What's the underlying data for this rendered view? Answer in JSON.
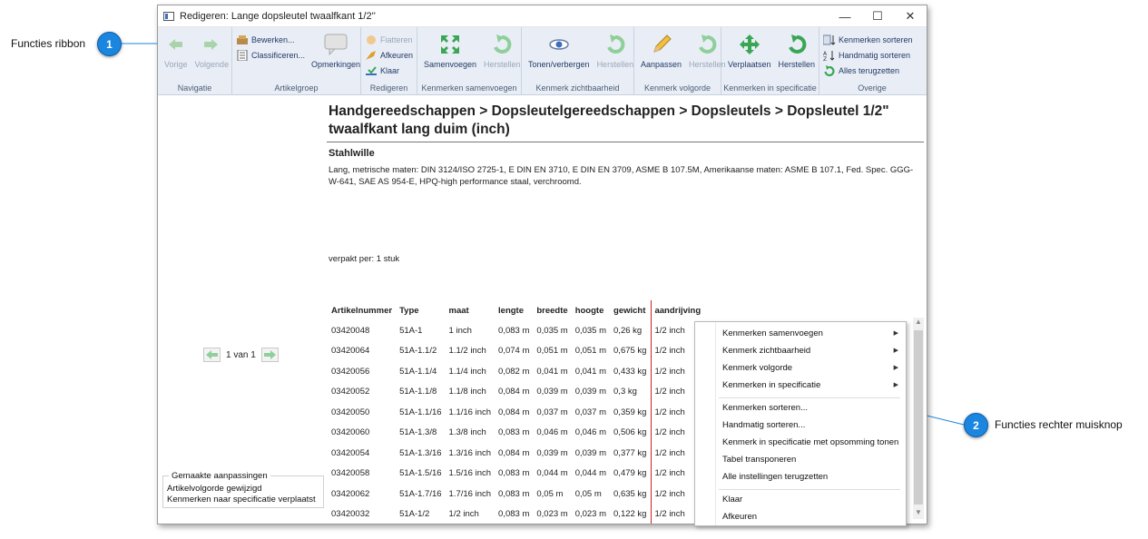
{
  "window": {
    "title": "Redigeren: Lange dopsleutel twaalfkant 1/2''"
  },
  "callouts": [
    {
      "number": "1",
      "label": "Functies ribbon"
    },
    {
      "number": "2",
      "label": "Functies rechter muisknop"
    }
  ],
  "ribbon": {
    "navigatie": {
      "label": "Navigatie",
      "vorige": "Vorige",
      "volgende": "Volgende"
    },
    "artikelgroep": {
      "label": "Artikelgroep",
      "bewerken": "Bewerken...",
      "classificeren": "Classificeren...",
      "opmerkingen": "Opmerkingen"
    },
    "redigeren": {
      "label": "Redigeren",
      "fiatteren": "Fiatteren",
      "afkeuren": "Afkeuren",
      "klaar": "Klaar"
    },
    "samenvoegen": {
      "label": "Kenmerken samenvoegen",
      "samenvoegen": "Samenvoegen",
      "herstellen": "Herstellen"
    },
    "zichtbaarheid": {
      "label": "Kenmerk zichtbaarheid",
      "tonen": "Tonen/verbergen",
      "herstellen": "Herstellen"
    },
    "volgorde": {
      "label": "Kenmerk volgorde",
      "aanpassen": "Aanpassen",
      "herstellen": "Herstellen"
    },
    "specificatie": {
      "label": "Kenmerken in specificatie",
      "verplaatsen": "Verplaatsen",
      "herstellen": "Herstellen"
    },
    "overige": {
      "label": "Overige",
      "sorteren": "Kenmerken sorteren",
      "handmatig": "Handmatig sorteren",
      "terugzetten": "Alles terugzetten"
    }
  },
  "pager": {
    "text": "1 van 1"
  },
  "changes": {
    "legend": "Gemaakte aanpassingen",
    "items": [
      "Artikelvolgorde gewijzigd",
      "Kenmerken naar specificatie verplaatst"
    ]
  },
  "article": {
    "breadcrumb": "Handgereedschappen > Dopsleutelgereedschappen > Dopsleutels > Dopsleutel 1/2\" twaalfkant lang duim (inch)",
    "brand": "Stahlwille",
    "description": "Lang, metrische maten: DIN 3124/ISO 2725-1, E DIN EN 3710, E DIN EN 3709, ASME B 107.5M, Amerikaanse maten: ASME B 107.1, Fed. Spec. GGG-W-641, SAE AS 954-E, HPQ-high performance staal, verchroomd.",
    "packaging": "verpakt per: 1 stuk"
  },
  "table": {
    "headers": [
      "Artikelnummer",
      "Type",
      "maat",
      "lengte",
      "breedte",
      "hoogte",
      "gewicht",
      "aandrijving"
    ],
    "rows": [
      [
        "03420048",
        "51A-1",
        "1 inch",
        "0,083 m",
        "0,035 m",
        "0,035 m",
        "0,26 kg",
        "1/2 inch"
      ],
      [
        "03420064",
        "51A-1.1/2",
        "1.1/2 inch",
        "0,074 m",
        "0,051 m",
        "0,051 m",
        "0,675 kg",
        "1/2 inch"
      ],
      [
        "03420056",
        "51A-1.1/4",
        "1.1/4 inch",
        "0,082 m",
        "0,041 m",
        "0,041 m",
        "0,433 kg",
        "1/2 inch"
      ],
      [
        "03420052",
        "51A-1.1/8",
        "1.1/8 inch",
        "0,084 m",
        "0,039 m",
        "0,039 m",
        "0,3 kg",
        "1/2 inch"
      ],
      [
        "03420050",
        "51A-1.1/16",
        "1.1/16 inch",
        "0,084 m",
        "0,037 m",
        "0,037 m",
        "0,359 kg",
        "1/2 inch"
      ],
      [
        "03420060",
        "51A-1.3/8",
        "1.3/8 inch",
        "0,083 m",
        "0,046 m",
        "0,046 m",
        "0,506 kg",
        "1/2 inch"
      ],
      [
        "03420054",
        "51A-1.3/16",
        "1.3/16 inch",
        "0,084 m",
        "0,039 m",
        "0,039 m",
        "0,377 kg",
        "1/2 inch"
      ],
      [
        "03420058",
        "51A-1.5/16",
        "1.5/16 inch",
        "0,083 m",
        "0,044 m",
        "0,044 m",
        "0,479 kg",
        "1/2 inch"
      ],
      [
        "03420062",
        "51A-1.7/16",
        "1.7/16 inch",
        "0,083 m",
        "0,05 m",
        "0,05 m",
        "0,635 kg",
        "1/2 inch"
      ],
      [
        "03420032",
        "51A-1/2",
        "1/2 inch",
        "0,083 m",
        "0,023 m",
        "0,023 m",
        "0,122 kg",
        "1/2 inch"
      ]
    ]
  },
  "context_menu": {
    "items": [
      "Kenmerken samenvoegen",
      "Kenmerk zichtbaarheid",
      "Kenmerk volgorde",
      "Kenmerken in specificatie",
      "Kenmerken sorteren...",
      "Handmatig sorteren...",
      "Kenmerk in specificatie met opsomming tonen",
      "Tabel transponeren",
      "Alle instellingen terugzetten",
      "Klaar",
      "Afkeuren"
    ]
  },
  "colors": {
    "callout": "#1a86e0",
    "ribbon": "#e9eef6",
    "icon_green": "#3aa655",
    "accent_red": "#d02020"
  }
}
